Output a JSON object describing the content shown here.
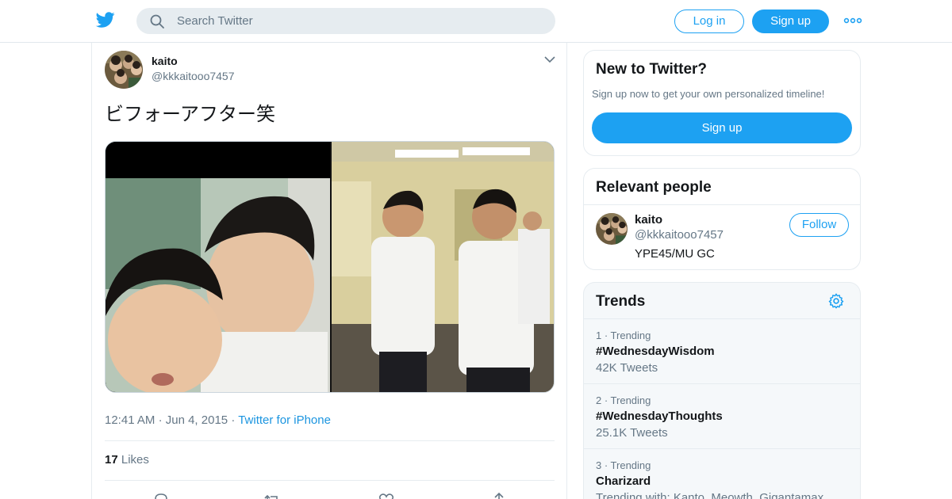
{
  "topbar": {
    "logo_icon": "twitter-bird-icon",
    "search_placeholder": "Search Twitter",
    "login_label": "Log in",
    "signup_label": "Sign up",
    "more_icon": "more-dots-icon"
  },
  "colors": {
    "brand": "#1da1f2",
    "text": "#14171a",
    "muted": "#657786",
    "border": "#e6ecf0"
  },
  "tweet": {
    "author_name": "kaito",
    "author_handle": "@kkkaitooo7457",
    "text": "ビフォーアフター笑",
    "time": "12:41 AM",
    "date": "Jun 4, 2015",
    "source": "Twitter for iPhone",
    "likes_count": "17",
    "likes_label": "Likes"
  },
  "new_to_twitter": {
    "title": "New to Twitter?",
    "subtitle": "Sign up now to get your own personalized timeline!",
    "button": "Sign up"
  },
  "relevant_people": {
    "title": "Relevant people",
    "person": {
      "name": "kaito",
      "handle": "@kkkaitooo7457",
      "bio": "YPE45/MU GC",
      "follow_label": "Follow"
    }
  },
  "trends": {
    "title": "Trends",
    "items": [
      {
        "rank": "1 · Trending",
        "name": "#WednesdayWisdom",
        "count": "42K Tweets"
      },
      {
        "rank": "2 · Trending",
        "name": "#WednesdayThoughts",
        "count": "25.1K Tweets"
      },
      {
        "rank": "3 · Trending",
        "name": "Charizard",
        "count": "Trending with: Kanto, Meowth, Gigantamax"
      }
    ]
  }
}
